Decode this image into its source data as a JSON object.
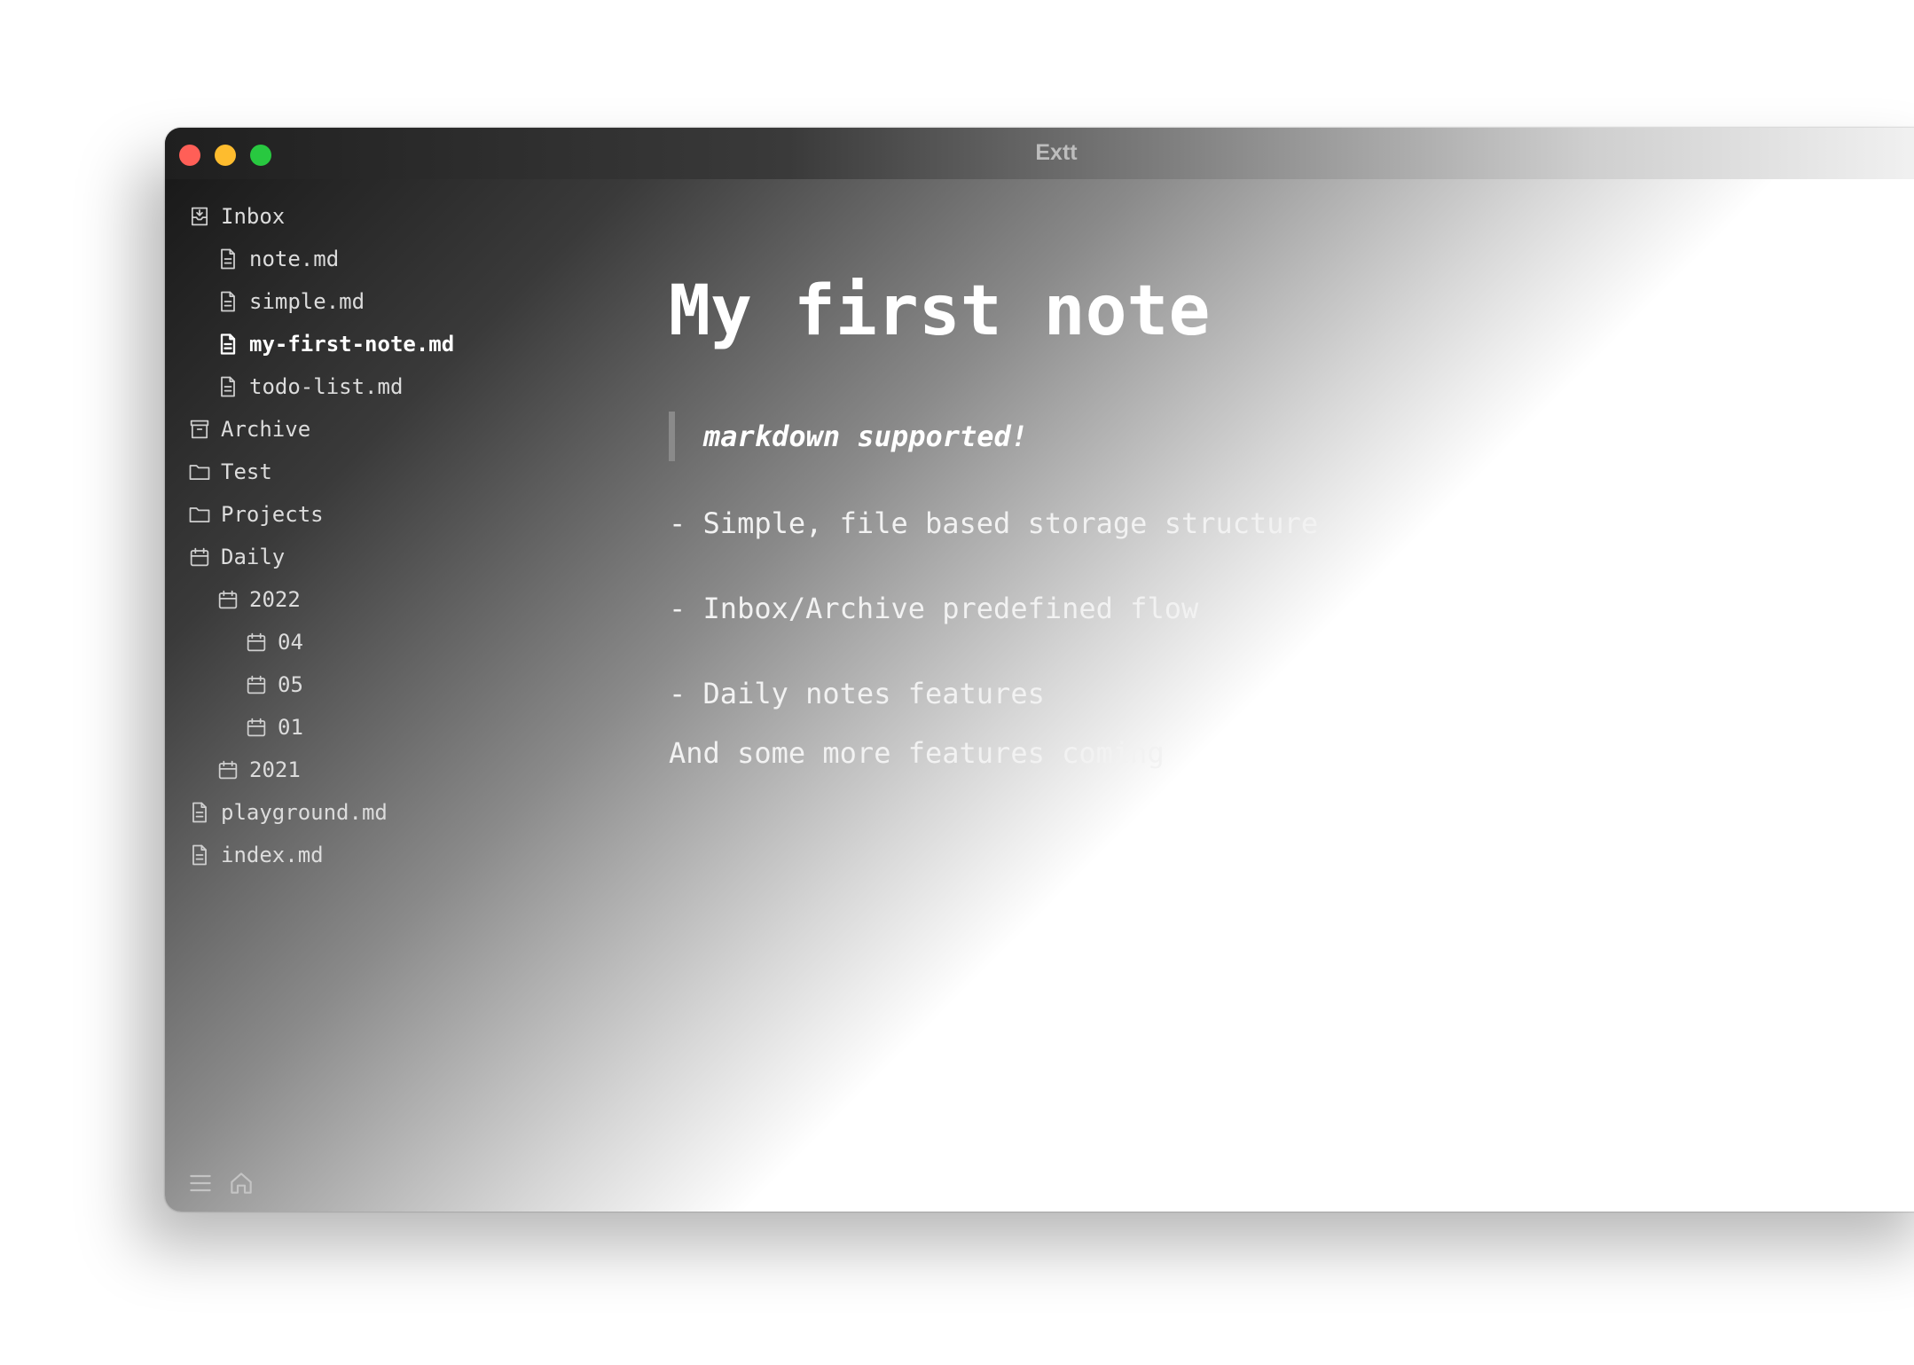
{
  "window": {
    "title": "Extt"
  },
  "sidebar": {
    "items": [
      {
        "label": "Inbox",
        "icon": "inbox-icon",
        "level": 0,
        "active": false
      },
      {
        "label": "note.md",
        "icon": "file-icon",
        "level": 1,
        "active": false
      },
      {
        "label": "simple.md",
        "icon": "file-icon",
        "level": 1,
        "active": false
      },
      {
        "label": "my-first-note.md",
        "icon": "file-icon",
        "level": 1,
        "active": true
      },
      {
        "label": "todo-list.md",
        "icon": "file-icon",
        "level": 1,
        "active": false
      },
      {
        "label": "Archive",
        "icon": "archive-icon",
        "level": 0,
        "active": false
      },
      {
        "label": "Test",
        "icon": "folder-icon",
        "level": 0,
        "active": false
      },
      {
        "label": "Projects",
        "icon": "folder-icon",
        "level": 0,
        "active": false
      },
      {
        "label": "Daily",
        "icon": "calendar-icon",
        "level": 0,
        "active": false
      },
      {
        "label": "2022",
        "icon": "calendar-icon",
        "level": 1,
        "active": false
      },
      {
        "label": "04",
        "icon": "calendar-icon",
        "level": 2,
        "active": false
      },
      {
        "label": "05",
        "icon": "calendar-icon",
        "level": 2,
        "active": false
      },
      {
        "label": "01",
        "icon": "calendar-icon",
        "level": 2,
        "active": false
      },
      {
        "label": "2021",
        "icon": "calendar-icon",
        "level": 1,
        "active": false
      },
      {
        "label": "playground.md",
        "icon": "file-icon",
        "level": 0,
        "active": false
      },
      {
        "label": "index.md",
        "icon": "file-icon",
        "level": 0,
        "active": false
      }
    ],
    "footer": {
      "menu_icon": "menu-icon",
      "home_icon": "home-icon"
    }
  },
  "editor": {
    "title": "My first note",
    "quote": "markdown supported!",
    "bullets": [
      "- Simple, file based storage structure",
      "- Inbox/Archive predefined flow",
      "- Daily notes features"
    ],
    "closing": "And some more features coming"
  },
  "colors": {
    "close": "#ff5f57",
    "minimize": "#febc2e",
    "maximize": "#28c840",
    "quote_bar": "#8a8a8a"
  }
}
